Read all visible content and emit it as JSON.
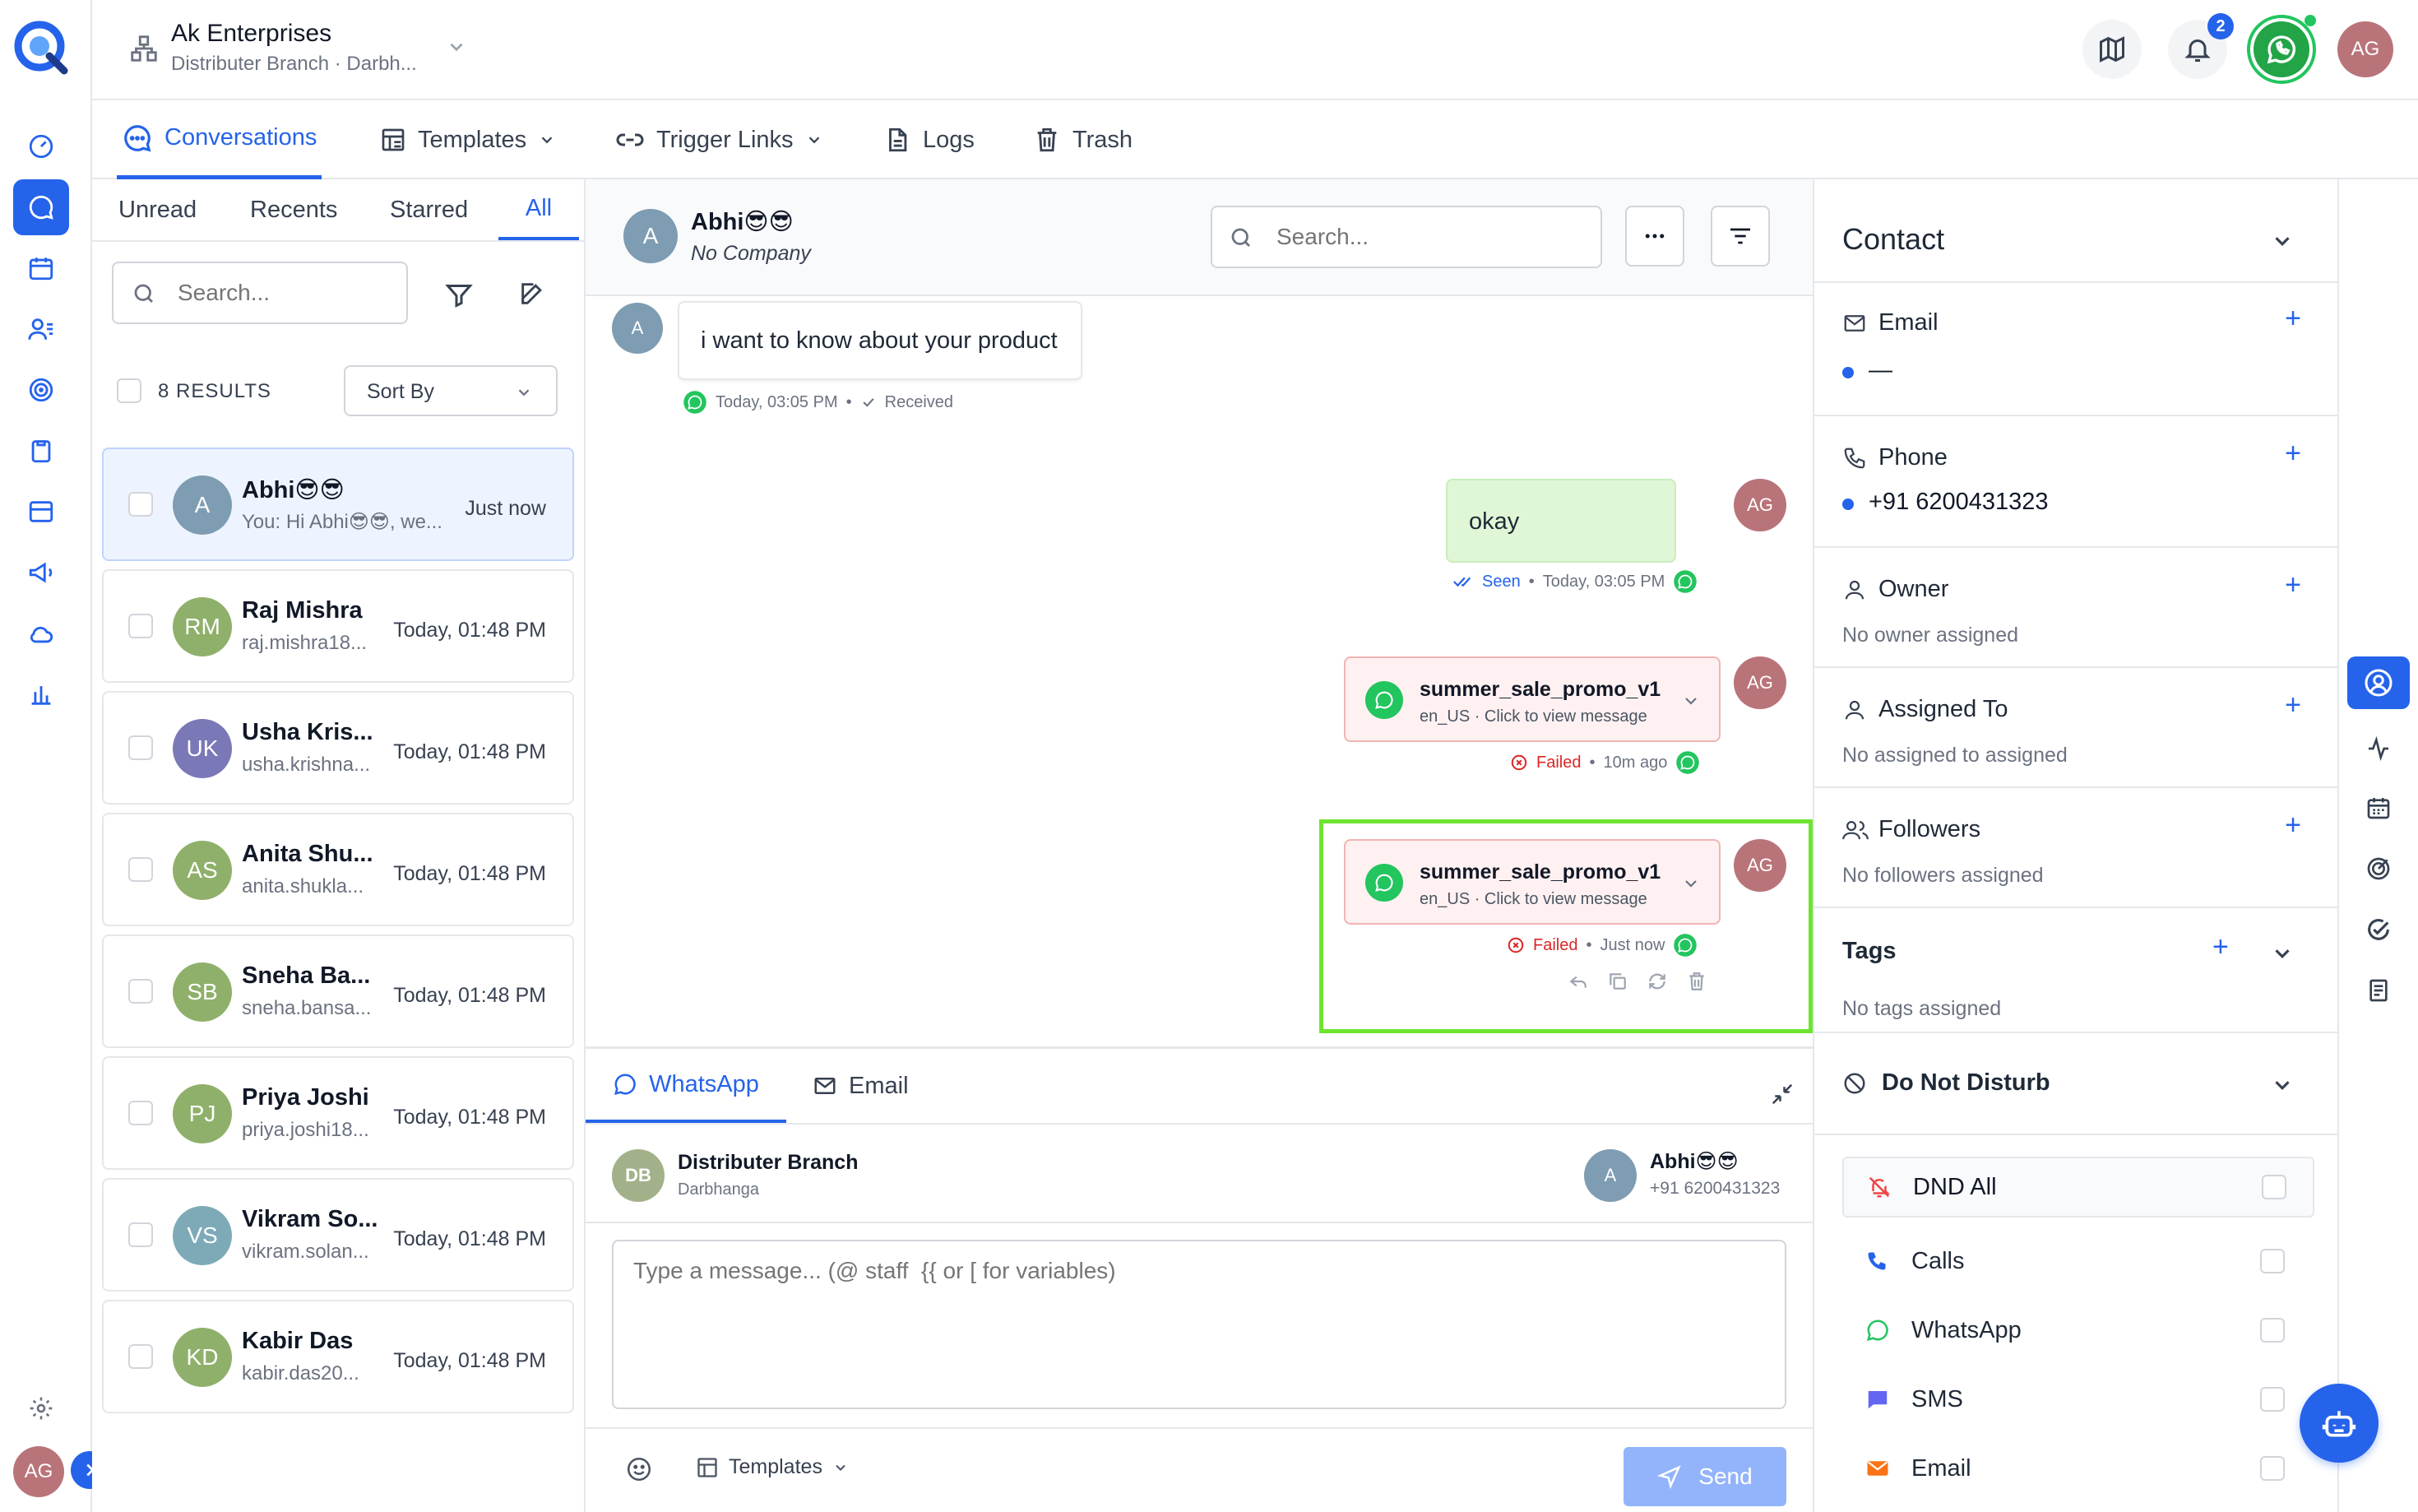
{
  "app": {
    "org_name": "Ak Enterprises",
    "org_sub": "Distributer Branch · Darbh...",
    "notif_count": "2",
    "user_initials": "AG"
  },
  "colors": {
    "accent": "#2563eb",
    "whatsapp": "#22c55e",
    "failed": "#dc2626",
    "highlight": "#6ee42f"
  },
  "tabs": {
    "conversations": "Conversations",
    "templates": "Templates",
    "trigger_links": "Trigger Links",
    "logs": "Logs",
    "trash": "Trash"
  },
  "list": {
    "filters": [
      "Unread",
      "Recents",
      "Starred",
      "All"
    ],
    "search_placeholder": "Search...",
    "results": "8 RESULTS",
    "sort_label": "Sort By",
    "items": [
      {
        "initials": "A",
        "color": "#7e9cb2",
        "name": "Abhi😎😎",
        "sub": "You: Hi Abhi😎😎, we...",
        "time": "Just now"
      },
      {
        "initials": "RM",
        "color": "#8fb06a",
        "name": "Raj Mishra",
        "sub": "raj.mishra18...",
        "time": "Today, 01:48 PM"
      },
      {
        "initials": "UK",
        "color": "#7b78b8",
        "name": "Usha Kris...",
        "sub": "usha.krishna...",
        "time": "Today, 01:48 PM"
      },
      {
        "initials": "AS",
        "color": "#8fb06a",
        "name": "Anita Shu...",
        "sub": "anita.shukla...",
        "time": "Today, 01:48 PM"
      },
      {
        "initials": "SB",
        "color": "#8fb06a",
        "name": "Sneha Ba...",
        "sub": "sneha.bansa...",
        "time": "Today, 01:48 PM"
      },
      {
        "initials": "PJ",
        "color": "#8fb06a",
        "name": "Priya Joshi",
        "sub": "priya.joshi18...",
        "time": "Today, 01:48 PM"
      },
      {
        "initials": "VS",
        "color": "#7eaab8",
        "name": "Vikram So...",
        "sub": "vikram.solan...",
        "time": "Today, 01:48 PM"
      },
      {
        "initials": "KD",
        "color": "#8fb06a",
        "name": "Kabir Das",
        "sub": "kabir.das20...",
        "time": "Today, 01:48 PM"
      }
    ]
  },
  "chat": {
    "contact_initial": "A",
    "contact_name": "Abhi😎😎",
    "contact_company": "No Company",
    "search_placeholder": "Search...",
    "msg_in_text": "i want to know about your product",
    "msg_in_time": "Today, 03:05 PM",
    "msg_in_status": "Received",
    "msg_out_text": "okay",
    "msg_out_status": "Seen",
    "msg_out_time": "Today, 03:05 PM",
    "tpl_name": "summer_sale_promo_v1",
    "tpl_sub": "en_US · Click to view message",
    "failed_label": "Failed",
    "tpl1_time": "10m ago",
    "tpl2_time": "Just now",
    "sender_initials": "AG"
  },
  "composer": {
    "tab_whatsapp": "WhatsApp",
    "tab_email": "Email",
    "from_initials": "DB",
    "from_name": "Distributer Branch",
    "from_sub": "Darbhanga",
    "to_initial": "A",
    "to_name": "Abhi😎😎",
    "to_phone": "+91 6200431323",
    "placeholder": "Type a message... (@ staff  {{ or [ for variables)",
    "templates_label": "Templates",
    "send_label": "Send"
  },
  "contact": {
    "title": "Contact",
    "email_label": "Email",
    "email_value": "—",
    "phone_label": "Phone",
    "phone_value": "+91 6200431323",
    "owner_label": "Owner",
    "owner_empty": "No owner assigned",
    "assigned_label": "Assigned To",
    "assigned_empty": "No assigned to assigned",
    "followers_label": "Followers",
    "followers_empty": "No followers assigned",
    "tags_label": "Tags",
    "tags_empty": "No tags assigned",
    "dnd_label": "Do Not Disturb",
    "dnd_all": "DND All",
    "dnd_calls": "Calls",
    "dnd_whatsapp": "WhatsApp",
    "dnd_sms": "SMS",
    "dnd_email": "Email"
  }
}
